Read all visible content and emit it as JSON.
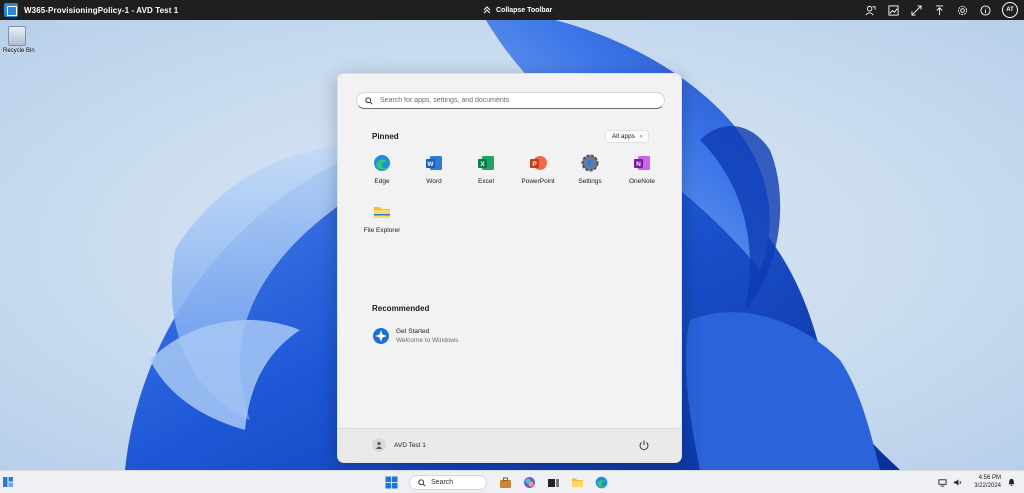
{
  "toolbar": {
    "title": "W365-ProvisioningPolicy-1 - AVD Test 1",
    "collapse_label": "Collapse Toolbar",
    "avatar_initials": "AT",
    "tools": [
      "remote-app-icon",
      "image-icon",
      "expand-icon",
      "pin-icon",
      "settings-icon",
      "info-icon"
    ]
  },
  "desktop": {
    "recycle_label": "Recycle Bin"
  },
  "start_menu": {
    "search_placeholder": "Search for apps, settings, and documents",
    "pinned_title": "Pinned",
    "all_apps_label": "All apps",
    "pinned": [
      {
        "name": "Edge",
        "icon": "edge-icon"
      },
      {
        "name": "Word",
        "icon": "word-icon"
      },
      {
        "name": "Excel",
        "icon": "excel-icon"
      },
      {
        "name": "PowerPoint",
        "icon": "powerpoint-icon"
      },
      {
        "name": "Settings",
        "icon": "settings-icon"
      },
      {
        "name": "OneNote",
        "icon": "onenote-icon"
      },
      {
        "name": "File Explorer",
        "icon": "folder-icon"
      }
    ],
    "recommended_title": "Recommended",
    "recommended": [
      {
        "title": "Get Started",
        "subtitle": "Welcome to Windows",
        "icon": "get-started-icon"
      }
    ],
    "user_name": "AVD Test 1"
  },
  "taskbar": {
    "search_label": "Search",
    "time": "4:56 PM",
    "date": "3/22/2024"
  },
  "colors": {
    "toolbar_bg": "#1f1f1f",
    "accent_blue": "#1a5fd8",
    "start_bg": "#f2f2f2",
    "taskbar_bg": "#eef0f3"
  }
}
